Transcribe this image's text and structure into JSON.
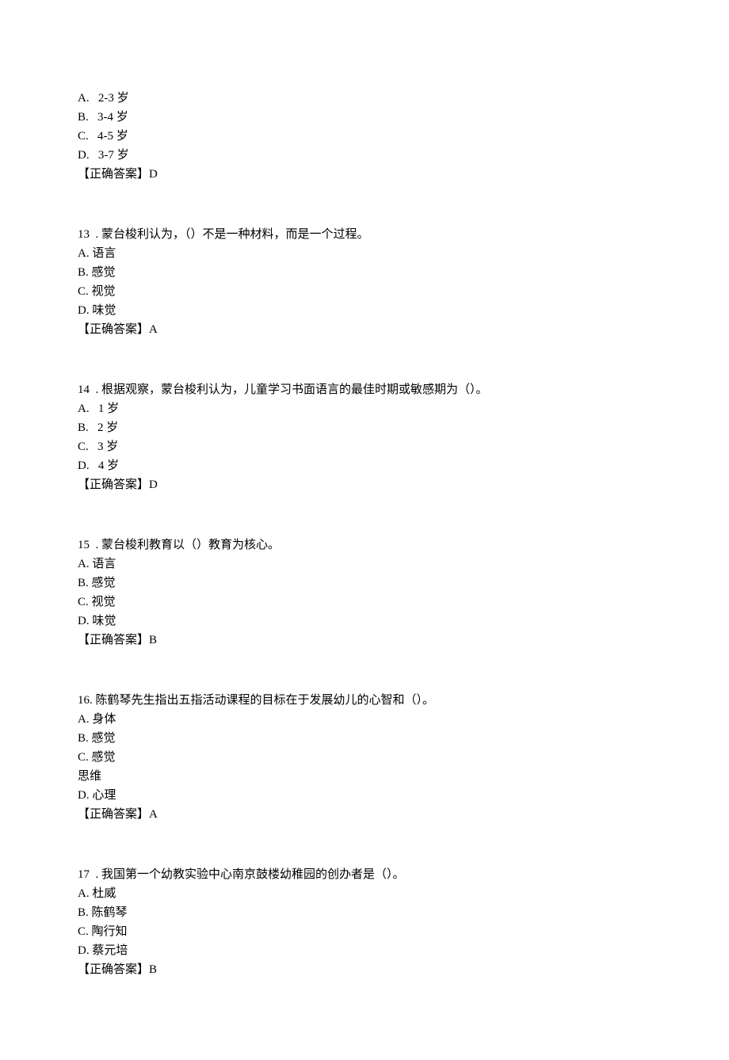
{
  "blocks": [
    {
      "lines": [
        "A.   2-3 岁",
        "B.   3-4 岁",
        "C.   4-5 岁",
        "D.   3-7 岁",
        "【正确答案】D"
      ]
    },
    {
      "lines": [
        "13  . 蒙台梭利认为，（）不是一种材料，而是一个过程。",
        "A. 语言",
        "B. 感觉",
        "C. 视觉",
        "D. 味觉",
        "【正确答案】A"
      ]
    },
    {
      "lines": [
        "14  . 根据观察，蒙台梭利认为，儿童学习书面语言的最佳时期或敏感期为（）。",
        "A.   1 岁",
        "B.   2 岁",
        "C.   3 岁",
        "D.   4 岁",
        "【正确答案】D"
      ]
    },
    {
      "lines": [
        "15  . 蒙台梭利教育以（）教育为核心。",
        "A. 语言",
        "B. 感觉",
        "C. 视觉",
        "D. 味觉",
        "【正确答案】B"
      ]
    },
    {
      "lines": [
        "16. 陈鹤琴先生指出五指活动课程的目标在于发展幼儿的心智和（）。",
        "A. 身体",
        "B. 感觉",
        "C. 感觉",
        "思维",
        "D. 心理",
        "【正确答案】A"
      ]
    },
    {
      "lines": [
        "17  . 我国第一个幼教实验中心南京鼓楼幼稚园的创办者是（）。",
        "A. 杜威",
        "B. 陈鹤琴",
        "C. 陶行知",
        "D. 蔡元培",
        "【正确答案】B"
      ]
    }
  ]
}
